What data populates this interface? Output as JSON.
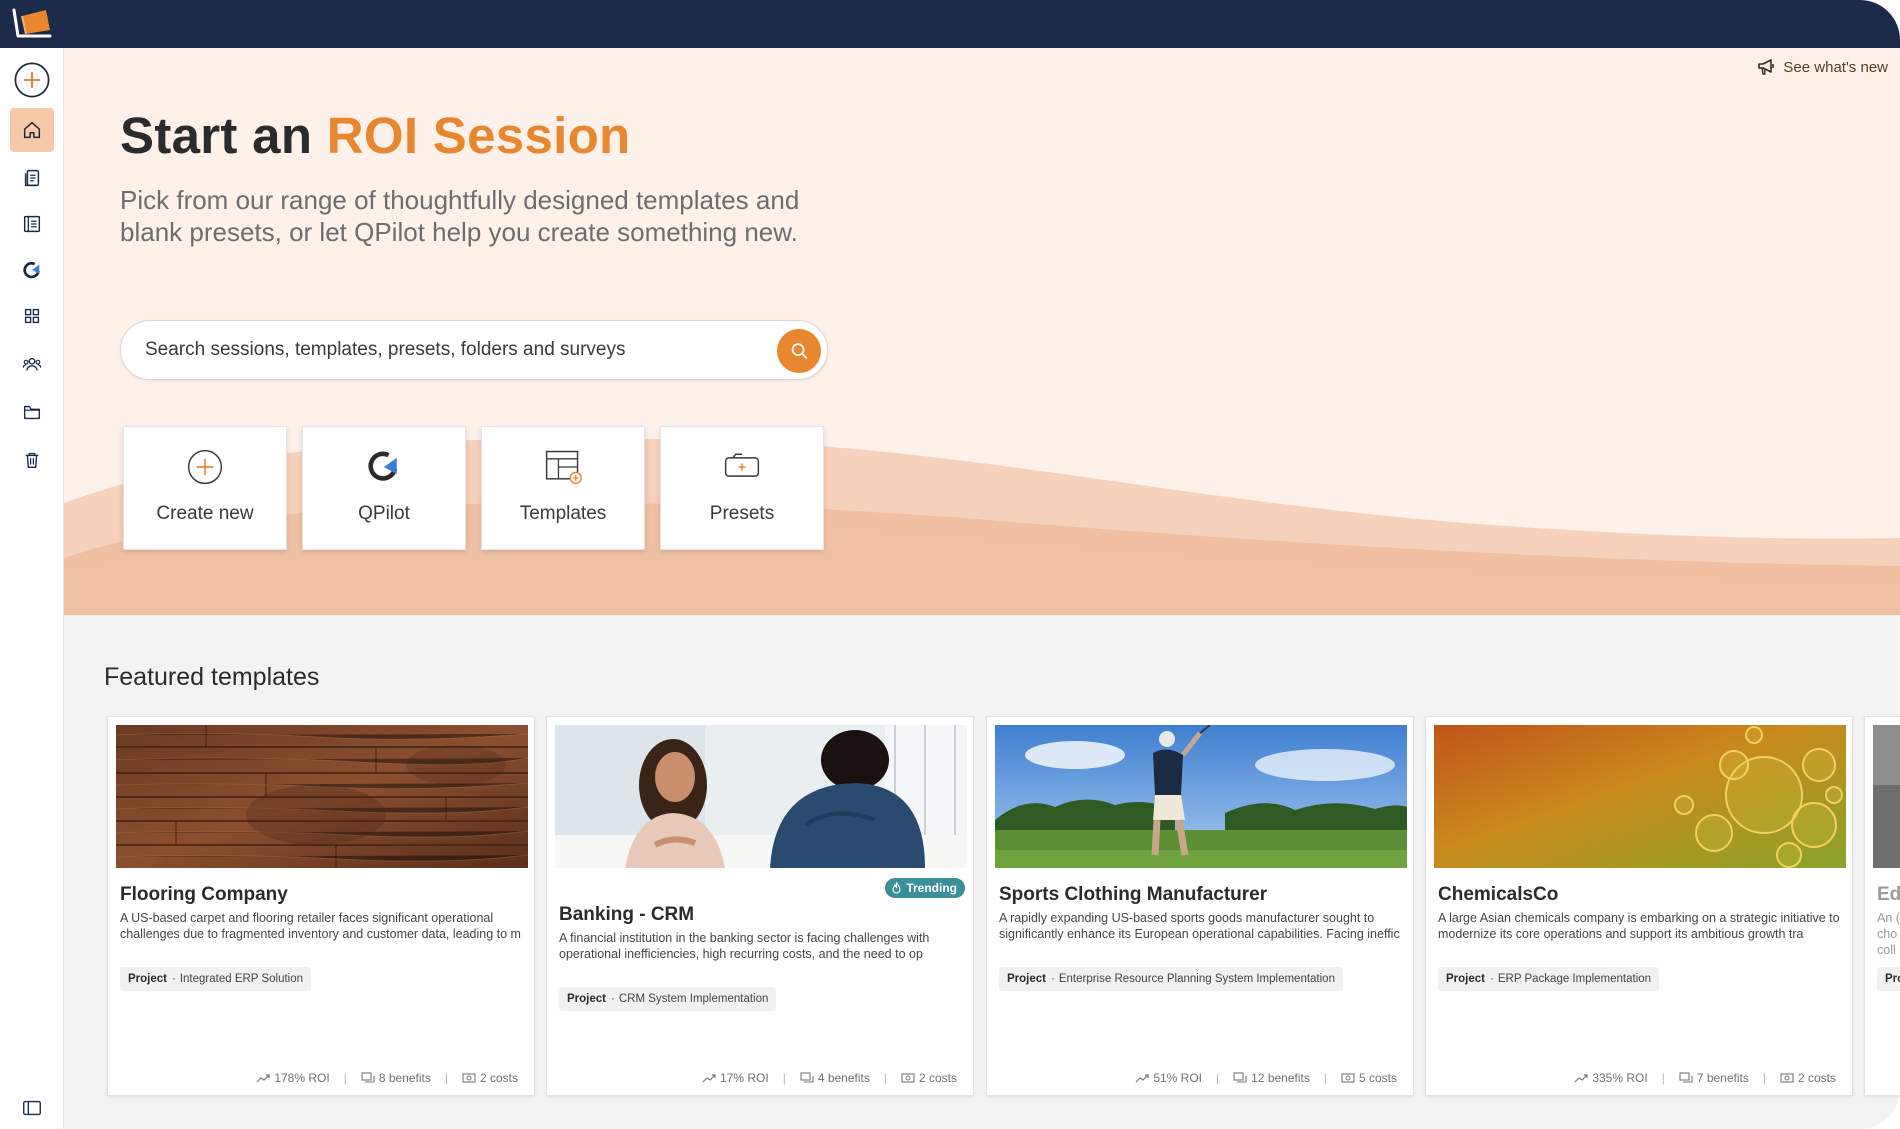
{
  "app": {
    "whats_new": "See what's new",
    "accent_color": "#e8872f",
    "navy_color": "#1c2a4a"
  },
  "sidebar": {
    "items": [
      {
        "icon": "plus-circle-icon",
        "active": false
      },
      {
        "icon": "home-icon",
        "active": true
      },
      {
        "icon": "documents-icon",
        "active": false
      },
      {
        "icon": "list-icon",
        "active": false
      },
      {
        "icon": "qpilot-icon",
        "active": false
      },
      {
        "icon": "grid-icon",
        "active": false
      },
      {
        "icon": "users-icon",
        "active": false
      },
      {
        "icon": "folder-icon",
        "active": false
      },
      {
        "icon": "trash-icon",
        "active": false
      }
    ],
    "footer_icon": "panel-toggle-icon"
  },
  "hero": {
    "title_prefix": "Start an",
    "title_accent": "ROI Session",
    "subtitle": "Pick from our range of thoughtfully designed templates and blank presets, or let QPilot help you create something new.",
    "search_placeholder": "Search sessions, templates, presets, folders and surveys"
  },
  "quick_actions": [
    {
      "label": "Create new",
      "icon": "plus-circle-icon"
    },
    {
      "label": "QPilot",
      "icon": "qpilot-icon"
    },
    {
      "label": "Templates",
      "icon": "templates-icon"
    },
    {
      "label": "Presets",
      "icon": "presets-icon"
    }
  ],
  "featured": {
    "title": "Featured templates",
    "cards": [
      {
        "title": "Flooring Company",
        "description": "A US-based carpet and flooring retailer faces significant operational challenges due to fragmented inventory and customer data, leading to m",
        "tag_type": "Project",
        "tag_value": "Integrated ERP Solution",
        "roi": "178% ROI",
        "benefits": "8 benefits",
        "costs": "2 costs",
        "trending": ""
      },
      {
        "title": "Banking - CRM",
        "description": "A financial institution in the banking sector is facing challenges with operational inefficiencies, high recurring costs, and the need to op",
        "tag_type": "Project",
        "tag_value": "CRM System Implementation",
        "roi": "17% ROI",
        "benefits": "4 benefits",
        "costs": "2 costs",
        "trending": "Trending"
      },
      {
        "title": "Sports Clothing Manufacturer",
        "description": "A rapidly expanding US-based sports goods manufacturer sought to significantly enhance its European operational capabilities. Facing ineffic",
        "tag_type": "Project",
        "tag_value": "Enterprise Resource Planning System Implementation",
        "roi": "51% ROI",
        "benefits": "12 benefits",
        "costs": "5 costs",
        "trending": ""
      },
      {
        "title": "ChemicalsCo",
        "description": "A large Asian chemicals company is embarking on a strategic initiative to modernize its core operations and support its ambitious growth tra",
        "tag_type": "Project",
        "tag_value": "ERP Package Implementation",
        "roi": "335% ROI",
        "benefits": "7 benefits",
        "costs": "2 costs",
        "trending": ""
      },
      {
        "title": "Ed",
        "description": "An ( cho coll",
        "tag_type": "Pro",
        "tag_value": "",
        "roi": "",
        "benefits": "",
        "costs": "",
        "trending": ""
      }
    ]
  }
}
